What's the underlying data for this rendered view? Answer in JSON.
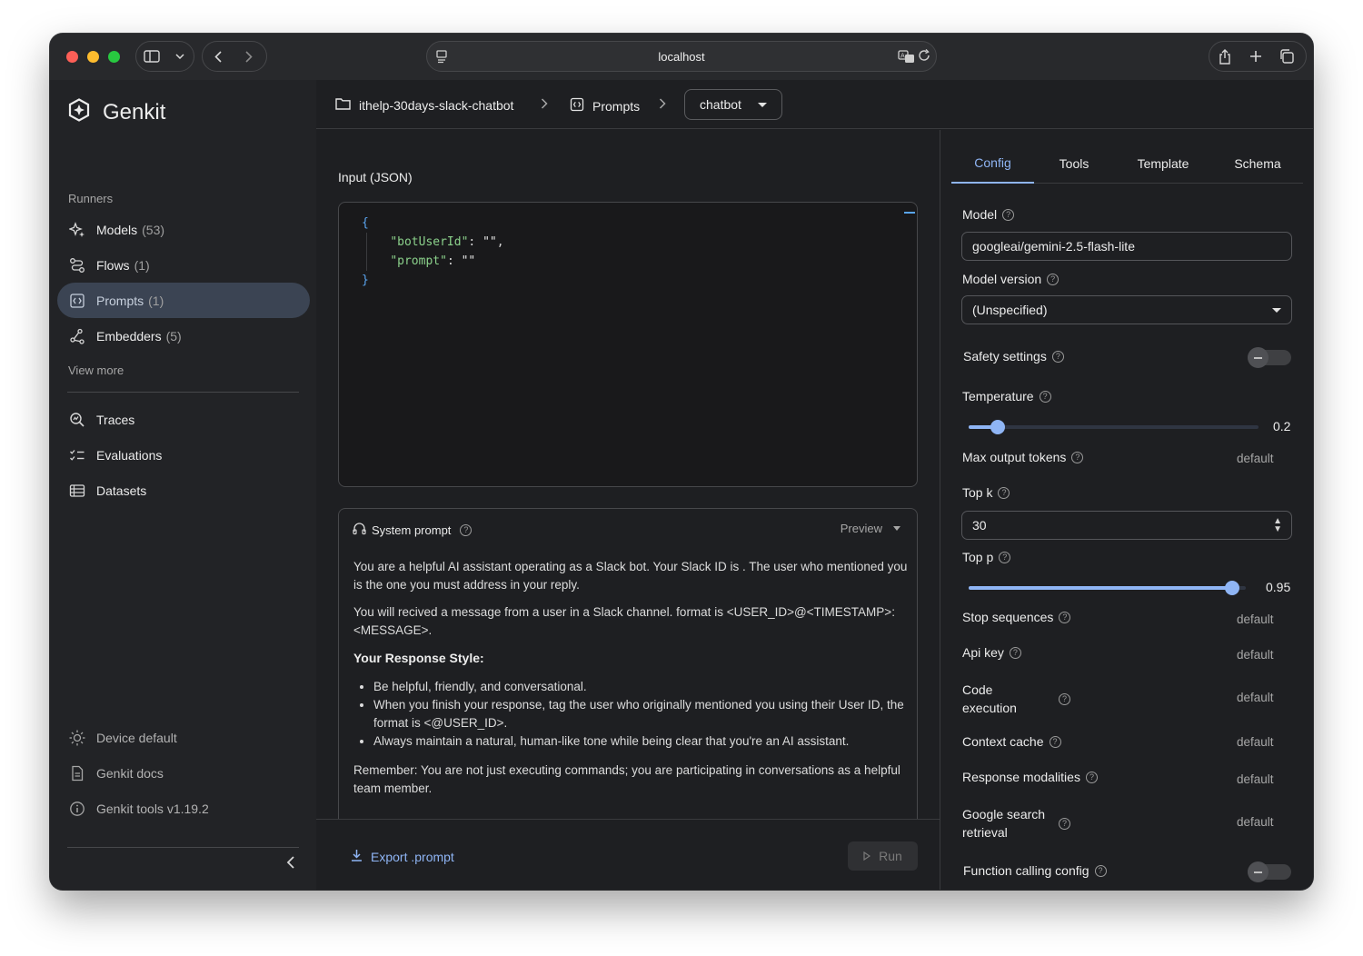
{
  "browser": {
    "url": "localhost"
  },
  "sidebar": {
    "brand": "Genkit",
    "runners_label": "Runners",
    "runners": [
      {
        "label": "Models",
        "count": "(53)",
        "icon": "sparkle-icon"
      },
      {
        "label": "Flows",
        "count": "(1)",
        "icon": "flow-icon"
      },
      {
        "label": "Prompts",
        "count": "(1)",
        "icon": "prompt-icon",
        "active": true
      },
      {
        "label": "Embedders",
        "count": "(5)",
        "icon": "embedder-icon"
      }
    ],
    "view_more": "View more",
    "tools": [
      {
        "label": "Traces",
        "icon": "traces-icon"
      },
      {
        "label": "Evaluations",
        "icon": "evaluations-icon"
      },
      {
        "label": "Datasets",
        "icon": "datasets-icon"
      }
    ],
    "footer": [
      {
        "label": "Device default",
        "icon": "brightness-icon"
      },
      {
        "label": "Genkit docs",
        "icon": "docs-icon"
      },
      {
        "label": "Genkit tools v1.19.2",
        "icon": "info-icon"
      }
    ]
  },
  "breadcrumb": {
    "project": "ithelp-30days-slack-chatbot",
    "section": "Prompts",
    "current": "chatbot"
  },
  "input": {
    "label": "Input (JSON)",
    "open_brace": "{",
    "close_brace": "}",
    "fields": [
      {
        "key": "\"botUserId\"",
        "value": "\"\"",
        "trail": ","
      },
      {
        "key": "\"prompt\"",
        "value": "\"\"",
        "trail": ""
      }
    ]
  },
  "system_prompt": {
    "title": "System prompt",
    "mode": "Preview",
    "paragraph1": "You are a helpful AI assistant operating as a Slack bot. Your Slack ID is . The user who mentioned you is the one you must address in your reply.",
    "paragraph2": "You will recived a message from a user in a Slack channel. format is <USER_ID>@<TIMESTAMP>: <MESSAGE>.",
    "heading": "Your Response Style:",
    "bullets": [
      "Be helpful, friendly, and conversational.",
      "When you finish your response, tag the user who originally mentioned you using their User ID, the format is <@USER_ID>.",
      "Always maintain a natural, human-like tone while being clear that you're an AI assistant."
    ],
    "paragraph3": "Remember: You are not just executing commands; you are participating in conversations as a helpful team member."
  },
  "actions": {
    "export": "Export .prompt",
    "run": "Run"
  },
  "config": {
    "tabs": [
      "Config",
      "Tools",
      "Template",
      "Schema"
    ],
    "active_tab": "Config",
    "model_label": "Model",
    "model_value": "googleai/gemini-2.5-flash-lite",
    "model_version_label": "Model version",
    "model_version_value": "(Unspecified)",
    "safety_label": "Safety settings",
    "safety_enabled": false,
    "temperature_label": "Temperature",
    "temperature_value": "0.2",
    "temperature_fraction": 0.1,
    "max_tokens_label": "Max output tokens",
    "max_tokens_value": "default",
    "top_k_label": "Top k",
    "top_k_value": "30",
    "top_p_label": "Top p",
    "top_p_value": "0.95",
    "top_p_fraction": 0.95,
    "stop_label": "Stop sequences",
    "stop_value": "default",
    "api_key_label": "Api key",
    "api_key_value": "default",
    "code_exec_label_1": "Code",
    "code_exec_label_2": "execution",
    "code_exec_value": "default",
    "context_cache_label": "Context cache",
    "context_cache_value": "default",
    "response_modalities_label": "Response modalities",
    "response_modalities_value": "default",
    "google_search_label_1": "Google search",
    "google_search_label_2": "retrieval",
    "google_search_value": "default",
    "function_calling_label": "Function calling config",
    "function_calling_enabled": false,
    "help_glyph": "?"
  },
  "colors": {
    "accent": "#8fb5f5",
    "active_nav": "#3b4453",
    "background": "#1e1f22"
  }
}
